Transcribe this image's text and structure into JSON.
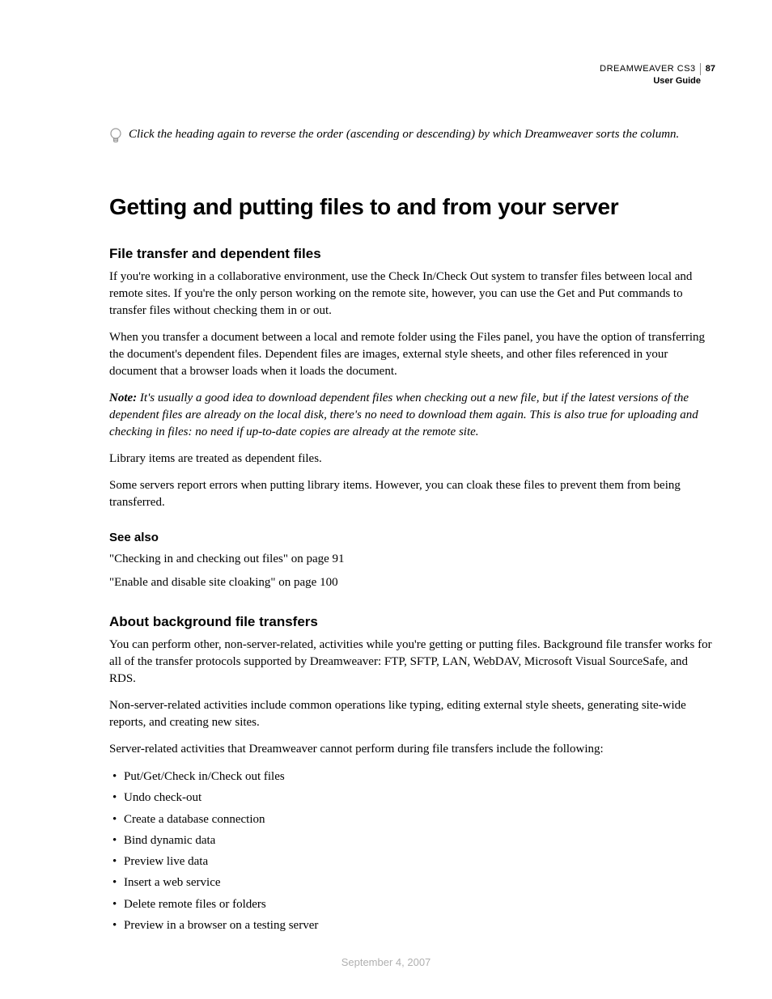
{
  "header": {
    "product": "DREAMWEAVER CS3",
    "page_number": "87",
    "subtitle": "User Guide"
  },
  "tip": {
    "text": "Click the heading again to reverse the order (ascending or descending) by which Dreamweaver sorts the column."
  },
  "main_heading": "Getting and putting files to and from your server",
  "section1": {
    "heading": "File transfer and dependent files",
    "p1": "If you're working in a collaborative environment, use the Check In/Check Out system to transfer files between local and remote sites. If you're the only person working on the remote site, however, you can use the Get and Put commands to transfer files without checking them in or out.",
    "p2": "When you transfer a document between a local and remote folder using the Files panel, you have the option of transferring the document's dependent files. Dependent files are images, external style sheets, and other files referenced in your document that a browser loads when it loads the document.",
    "note_label": "Note:",
    "note_body": " It's usually a good idea to download dependent files when checking out a new file, but if the latest versions of the dependent files are already on the local disk, there's no need to download them again. This is also true for uploading and checking in files: no need if up-to-date copies are already at the remote site.",
    "p4": "Library items are treated as dependent files.",
    "p5": "Some servers report errors when putting library items. However, you can cloak these files to prevent them from being transferred."
  },
  "see_also": {
    "heading": "See also",
    "links": [
      "\"Checking in and checking out files\" on page 91",
      "\"Enable and disable site cloaking\" on page 100"
    ]
  },
  "section2": {
    "heading": "About background file transfers",
    "p1": "You can perform other, non-server-related, activities while you're getting or putting files. Background file transfer works for all of the transfer protocols supported by Dreamweaver: FTP, SFTP, LAN, WebDAV, Microsoft Visual SourceSafe, and RDS.",
    "p2": "Non-server-related activities include common operations like typing, editing external style sheets, generating site-wide reports, and creating new sites.",
    "p3": "Server-related activities that Dreamweaver cannot perform during file transfers include the following:",
    "bullets": [
      "Put/Get/Check in/Check out files",
      "Undo check-out",
      "Create a database connection",
      "Bind dynamic data",
      "Preview live data",
      "Insert a web service",
      "Delete remote files or folders",
      "Preview in a browser on a testing server"
    ]
  },
  "footer_date": "September 4, 2007"
}
